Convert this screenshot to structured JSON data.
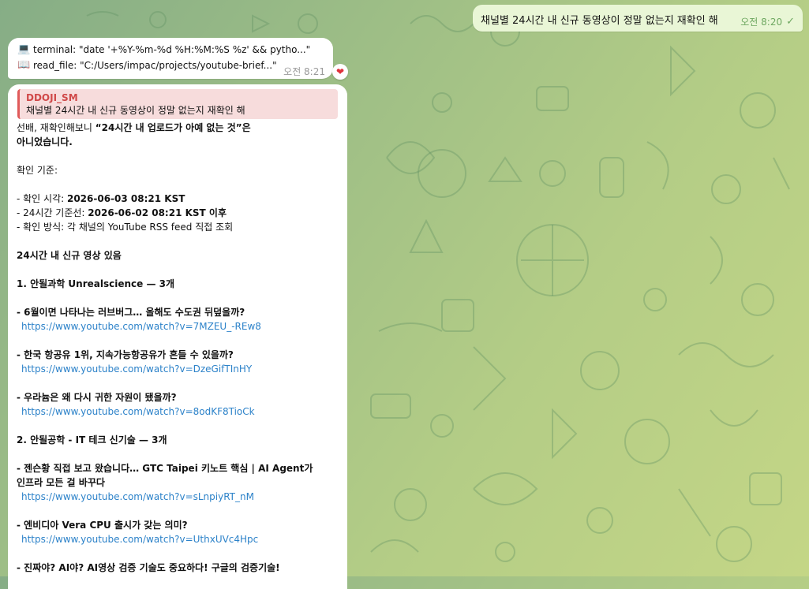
{
  "outgoing": {
    "text": "채널별 24시간 내 신규 동영상이 정말 없는지 재확인 해",
    "time": "오전 8:20",
    "status_icon": "double-check-icon"
  },
  "tool_message": {
    "lines": [
      {
        "icon": "💻",
        "icon_name": "laptop-icon",
        "text": "terminal: \"date '+%Y-%m-%d %H:%M:%S %z' && pytho...\""
      },
      {
        "icon": "📖",
        "icon_name": "book-icon",
        "text": "read_file: \"C:/Users/impac/projects/youtube-brief...\""
      }
    ],
    "time": "오전 8:21",
    "reaction": "❤"
  },
  "reply_message": {
    "quote": {
      "author": "DDOJI_SM",
      "text": "채널별 24시간 내 신규 동영상이 정말 없는지 재확인 해"
    },
    "intro_line1_prefix": "선배, 재확인해보니 ",
    "intro_line1_bold": "“24시간 내 업로드가 아예 없는 것”은",
    "intro_line2": "아니었습니다.",
    "criteria_title": "확인 기준:",
    "criteria": [
      {
        "label": "- 확인 시각: ",
        "value": "2026-06-03 08:21 KST"
      },
      {
        "label": "- 24시간 기준선: ",
        "value": "2026-06-02 08:21 KST 이후"
      },
      {
        "label": "- 확인 방식: ",
        "value": "각 채널의 YouTube RSS feed 직접 조회"
      }
    ],
    "section_heading": "24시간 내 신규 영상 있음",
    "channels": [
      {
        "heading": "1. 안될과학 Unrealscience — 3개",
        "videos": [
          {
            "title": "- 6월이면 나타나는 러브버그… 올해도 수도권 뒤덮을까?",
            "url": "https://www.youtube.com/watch?v=7MZEU_-REw8"
          },
          {
            "title": "- 한국 항공유 1위, 지속가능항공유가 흔들 수 있을까?",
            "url": "https://www.youtube.com/watch?v=DzeGifTInHY"
          },
          {
            "title": "- 우라늄은 왜 다시 귀한 자원이 됐을까?",
            "url": "https://www.youtube.com/watch?v=8odKF8TioCk"
          }
        ]
      },
      {
        "heading": "2. 안될공학 - IT 테크 신기술 — 3개",
        "videos": [
          {
            "title_lines": [
              "- 젠슨황 직접 보고 왔습니다… GTC Taipei 키노트 핵심 | AI Agent가",
              "인프라 모든 걸 바꾸다"
            ],
            "url": "https://www.youtube.com/watch?v=sLnpiyRT_nM"
          },
          {
            "title": "- 엔비디아 Vera CPU 출시가 갖는 의미?",
            "url": "https://www.youtube.com/watch?v=UthxUVc4Hpc"
          },
          {
            "title": "- 진짜야? AI야? AI영상 검증 기술도 중요하다! 구글의 검증기술!"
          }
        ]
      }
    ]
  }
}
